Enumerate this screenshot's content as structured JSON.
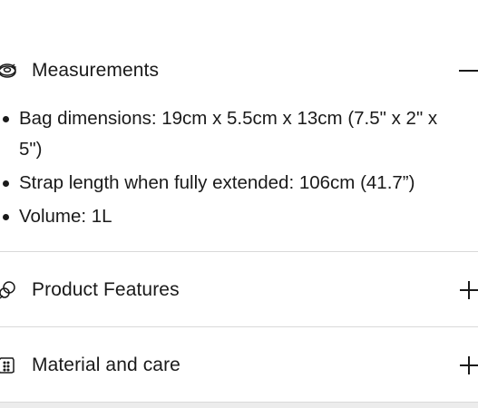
{
  "sections": [
    {
      "title": "Measurements",
      "icon": "tape-measure-icon",
      "toggle": "minus",
      "expanded": true,
      "items": [
        "Bag dimensions: 19cm x 5.5cm x 13cm (7.5\" x 2\" x 5\")",
        "Strap length when fully extended: 106cm (41.7”)",
        "Volume: 1L"
      ]
    },
    {
      "title": "Product Features",
      "icon": "features-icon",
      "toggle": "plus",
      "expanded": false
    },
    {
      "title": "Material and care",
      "icon": "fabric-swatch-icon",
      "toggle": "plus",
      "expanded": false
    }
  ]
}
